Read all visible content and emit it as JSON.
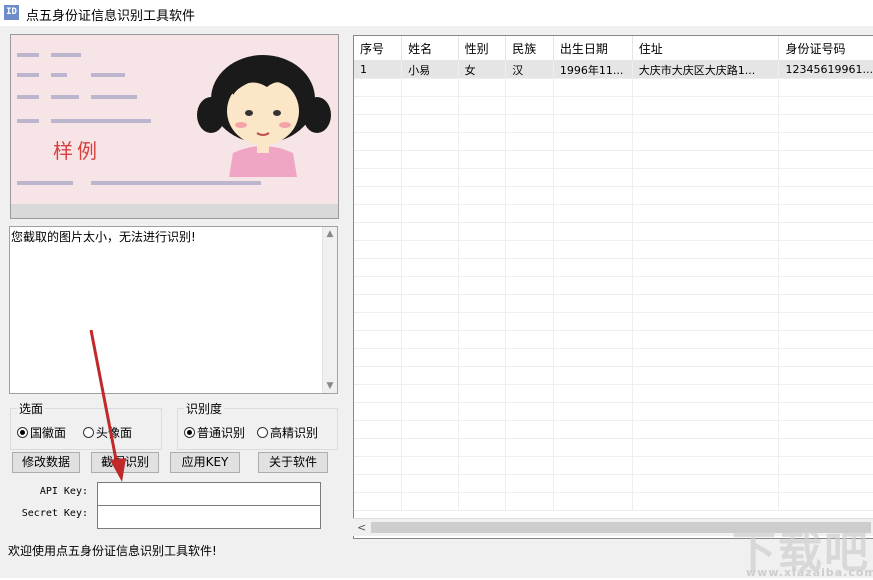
{
  "window": {
    "icon_text": "ID",
    "title": "点五身份证信息识别工具软件"
  },
  "message": "您截取的图片太小，无法进行识别!",
  "side_group": {
    "title": "选面",
    "options": [
      "国徽面",
      "头像面"
    ],
    "selected": 0
  },
  "accuracy_group": {
    "title": "识别度",
    "options": [
      "普通识别",
      "高精识别"
    ],
    "selected": 0
  },
  "buttons": {
    "modify": "修改数据",
    "capture": "截图识别",
    "apply_key": "应用KEY",
    "about": "关于软件"
  },
  "fields": {
    "api_key_label": "API Key:",
    "api_key_value": "",
    "secret_key_label": "Secret Key:",
    "secret_key_value": ""
  },
  "status": "欢迎使用点五身份证信息识别工具软件!",
  "table": {
    "columns": [
      "序号",
      "姓名",
      "性别",
      "民族",
      "出生日期",
      "住址",
      "身份证号码"
    ],
    "rows": [
      [
        "1",
        "小易",
        "女",
        "汉",
        "1996年11...",
        "大庆市大庆区大庆路1...",
        "12345619961..."
      ]
    ]
  },
  "sample_card": {
    "sample_mark": "样例"
  },
  "watermark": {
    "text": "下载吧",
    "sub": "www.xiazaiba.com"
  },
  "colors": {
    "arrow": "#c0282a",
    "selected_row": "#e5e5e5"
  }
}
